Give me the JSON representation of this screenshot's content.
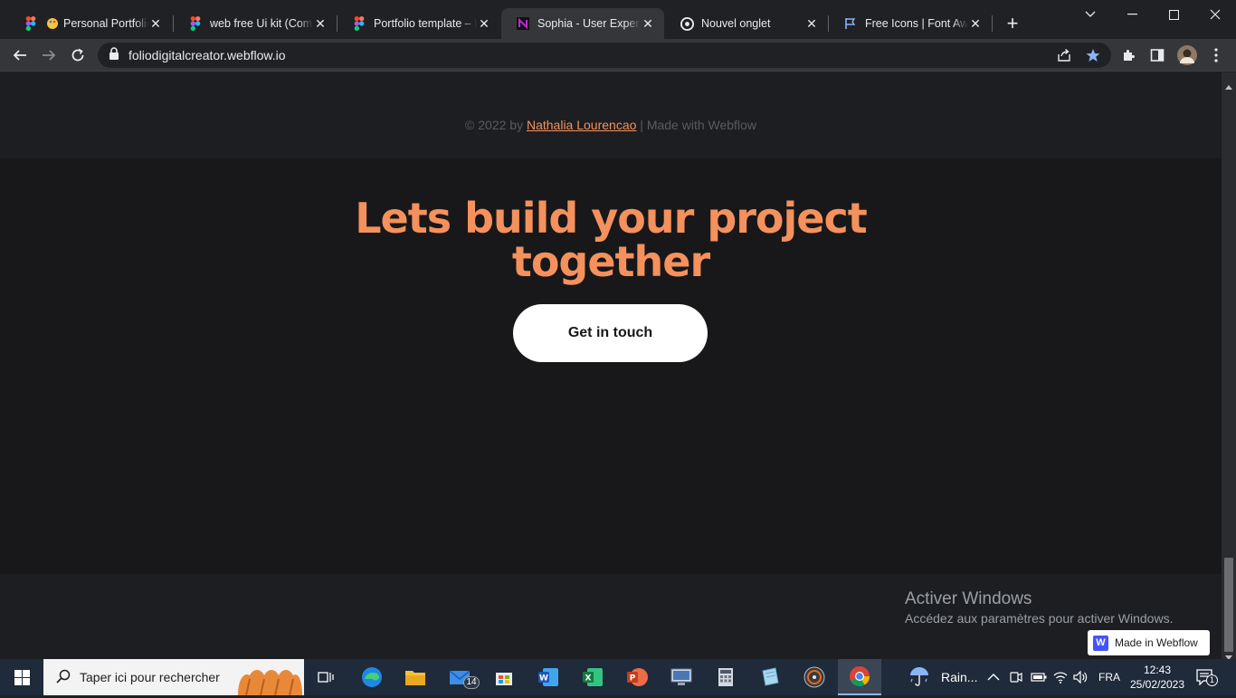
{
  "browser": {
    "tabs": [
      {
        "title": "Personal Portfolio",
        "icon": "figma-icon",
        "active": false
      },
      {
        "title": "web free Ui kit (Comm",
        "icon": "figma-icon",
        "active": false
      },
      {
        "title": "Portfolio template – Fi",
        "icon": "figma-icon",
        "active": false
      },
      {
        "title": "Sophia - User Experien",
        "icon": "webflow-n-icon",
        "active": true
      },
      {
        "title": "Nouvel onglet",
        "icon": "chrome-icon",
        "active": false
      },
      {
        "title": "Free Icons | Font Awes",
        "icon": "flag-icon",
        "active": false
      }
    ],
    "new_tab_symbol": "+",
    "close_symbol": "✕",
    "url": "foliodigitalcreator.webflow.io"
  },
  "page": {
    "headline_line1": "Lets build your project",
    "headline_line2": "together",
    "cta_label": "Get in touch",
    "footer": {
      "prefix": "© 2022 by ",
      "author": "Nathalia Lourencao",
      "separator": " | ",
      "suffix": "Made with Webflow"
    },
    "activation": {
      "title": "Activer Windows",
      "subtitle": "Accédez aux paramètres pour activer Windows."
    },
    "badge": {
      "logo": "W",
      "label": "Made in Webflow"
    }
  },
  "colors": {
    "accent": "#f4915c",
    "page_bg": "#18181b",
    "button_bg": "#ffffff"
  },
  "taskbar": {
    "search_placeholder": "Taper ici pour rechercher",
    "mail_badge": "14",
    "weather": "Rain...",
    "language": "FRA",
    "time": "12:43",
    "date": "25/02/2023",
    "notifications": "1"
  }
}
